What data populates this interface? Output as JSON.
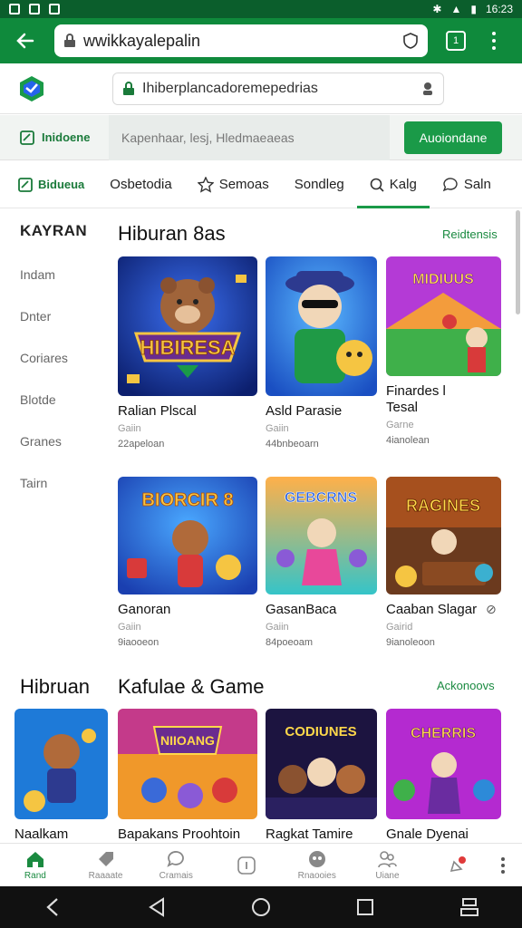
{
  "status_bar": {
    "time": "16:23"
  },
  "browser": {
    "url": "wwikkayalepalin",
    "tab_count": "1"
  },
  "site": {
    "search_placeholder": "Ihiberplancadoremepedrias"
  },
  "action_row": {
    "chip_label": "Inidoene",
    "filter_text": "Kapenhaar, lesj,  Hledmaeaeas",
    "cta_label": "Auoiondane"
  },
  "category_tabs": [
    {
      "label": "Bidueua",
      "icon": "edit-icon"
    },
    {
      "label": "Osbetodia",
      "icon": ""
    },
    {
      "label": "Semoas",
      "icon": "star-icon"
    },
    {
      "label": "Sondleg",
      "icon": ""
    },
    {
      "label": "Kalg",
      "icon": "search-icon"
    },
    {
      "label": "Saln",
      "icon": "chat-icon"
    }
  ],
  "sidebar": {
    "heading": "KAYRAN",
    "items": [
      "Indam",
      "Dnter",
      "Coriares",
      "Blotde",
      "Granes",
      "Tairn"
    ]
  },
  "section1": {
    "title": "Hiburan 8as",
    "link": "Reidtensis",
    "cards": [
      {
        "title": "Ralian Plscal",
        "genre": "Gaiin",
        "downloads": "22apeloan",
        "thumb_text": "HIBIRESA"
      },
      {
        "title": "Asld Parasie",
        "genre": "Gaiin",
        "downloads": "44bnbeoarn",
        "thumb_text": ""
      },
      {
        "title": "Finardes l Tesal",
        "genre": "Garne",
        "downloads": "4ianolean",
        "thumb_text": "MIDIUUS"
      },
      {
        "title": "Ganoran",
        "genre": "Gaiin",
        "downloads": "9iaooeon",
        "thumb_text": "BIORCIR 8"
      },
      {
        "title": "GasanBaca",
        "genre": "Gaiin",
        "downloads": "84poeoam",
        "thumb_text": "GEBCRNS"
      },
      {
        "title": "Caaban Slagar",
        "genre": "Gairid",
        "downloads": "9ianoleoon",
        "thumb_text": "RAGINES"
      }
    ]
  },
  "section2": {
    "side_title": "Hibruan",
    "title": "Kafulae & Game",
    "link": "Ackonoovs",
    "cards": [
      {
        "title": "Naalkam",
        "thumb_text": ""
      },
      {
        "title": "Bapakans Proohtoin",
        "thumb_text": "NIIOANG"
      },
      {
        "title": "Ragkat Tamire",
        "thumb_text": "CODIUNES"
      },
      {
        "title": "Gnale Dyenai",
        "thumb_text": "CHERRIS"
      }
    ]
  },
  "bottom_nav": [
    {
      "label": "Rand",
      "icon": "home-icon",
      "active": true
    },
    {
      "label": "Raaaate",
      "icon": "tag-icon",
      "active": false
    },
    {
      "label": "Cramais",
      "icon": "chat-icon",
      "active": false
    },
    {
      "label": "",
      "icon": "info-icon",
      "active": false
    },
    {
      "label": "Rnaooies",
      "icon": "game-icon",
      "active": false
    },
    {
      "label": "Uiane",
      "icon": "users-icon",
      "active": false
    },
    {
      "label": "",
      "icon": "notification-icon",
      "active": false
    }
  ],
  "colors": {
    "brand_green": "#0f8a3c",
    "status_green": "#0b5e2c",
    "cta_green": "#1a9a48",
    "link_green": "#1a8a40"
  }
}
